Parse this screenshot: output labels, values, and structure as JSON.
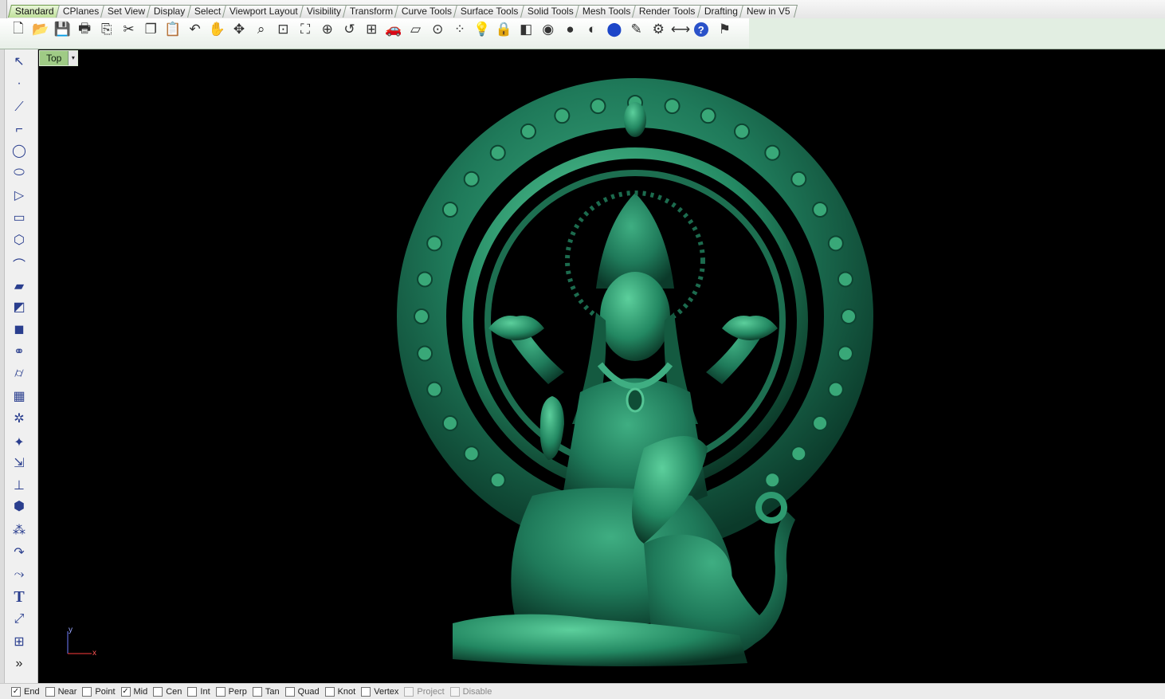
{
  "tabs": [
    {
      "label": "Standard",
      "active": true
    },
    {
      "label": "CPlanes",
      "active": false
    },
    {
      "label": "Set View",
      "active": false
    },
    {
      "label": "Display",
      "active": false
    },
    {
      "label": "Select",
      "active": false
    },
    {
      "label": "Viewport Layout",
      "active": false
    },
    {
      "label": "Visibility",
      "active": false
    },
    {
      "label": "Transform",
      "active": false
    },
    {
      "label": "Curve Tools",
      "active": false
    },
    {
      "label": "Surface Tools",
      "active": false
    },
    {
      "label": "Solid Tools",
      "active": false
    },
    {
      "label": "Mesh Tools",
      "active": false
    },
    {
      "label": "Render Tools",
      "active": false
    },
    {
      "label": "Drafting",
      "active": false
    },
    {
      "label": "New in V5",
      "active": false
    }
  ],
  "toolbar_icons": [
    "new-icon",
    "open-icon",
    "save-icon",
    "print-icon",
    "import-icon",
    "cut-icon",
    "copy-icon",
    "paste-icon",
    "undo-icon",
    "pan-icon",
    "rotate-view-icon",
    "zoom-icon",
    "zoom-window-icon",
    "zoom-extents-icon",
    "zoom-selected-icon",
    "undo-view-icon",
    "four-viewports-icon",
    "car-icon",
    "wireframe-plane-icon",
    "grid-snap-icon",
    "points-on-icon",
    "light-bulb-icon",
    "lock-icon",
    "layer-icon",
    "color-wheel-icon",
    "shaded-sphere-icon",
    "rendered-sphere-icon",
    "blue-sphere-icon",
    "highlighter-icon",
    "gear-icon",
    "dimension-icon",
    "help-icon",
    "tooltip-icon"
  ],
  "left_toolbar_icons": [
    "select-arrow-icon",
    "point-icon",
    "polyline-icon",
    "curve-control-points-icon",
    "circle-icon",
    "ellipse-icon",
    "polygon-arc-icon",
    "rectangle-icon",
    "polygon-icon",
    "curve-fillet-icon",
    "surface-corner-points-icon",
    "surface-extrude-icon",
    "box-solid-icon",
    "solid-union-icon",
    "cylinder-icon",
    "mesh-plane-icon",
    "mesh-tools-icon",
    "lights-icon",
    "transform-move-icon",
    "analyze-icon",
    "boolean-icon",
    "points-cloud-icon",
    "curve-edit-icon",
    "curve-offset-icon",
    "text-icon",
    "dimension-edit-icon",
    "group-icon",
    "more-tools-icon"
  ],
  "viewport": {
    "name": "Top",
    "dropdown_glyph": "▾",
    "axis_y": "y",
    "axis_x": "x"
  },
  "snaps": [
    {
      "label": "End",
      "checked": true,
      "enabled": true
    },
    {
      "label": "Near",
      "checked": false,
      "enabled": true
    },
    {
      "label": "Point",
      "checked": false,
      "enabled": true
    },
    {
      "label": "Mid",
      "checked": true,
      "enabled": true
    },
    {
      "label": "Cen",
      "checked": false,
      "enabled": true
    },
    {
      "label": "Int",
      "checked": false,
      "enabled": true
    },
    {
      "label": "Perp",
      "checked": false,
      "enabled": true
    },
    {
      "label": "Tan",
      "checked": false,
      "enabled": true
    },
    {
      "label": "Quad",
      "checked": false,
      "enabled": true
    },
    {
      "label": "Knot",
      "checked": false,
      "enabled": true
    },
    {
      "label": "Vertex",
      "checked": false,
      "enabled": true
    },
    {
      "label": "Project",
      "checked": false,
      "enabled": false
    },
    {
      "label": "Disable",
      "checked": false,
      "enabled": false
    }
  ],
  "colors": {
    "model_green": "#1f7a5a",
    "viewport_bg": "#000000",
    "active_tab": "#bfe09a"
  }
}
